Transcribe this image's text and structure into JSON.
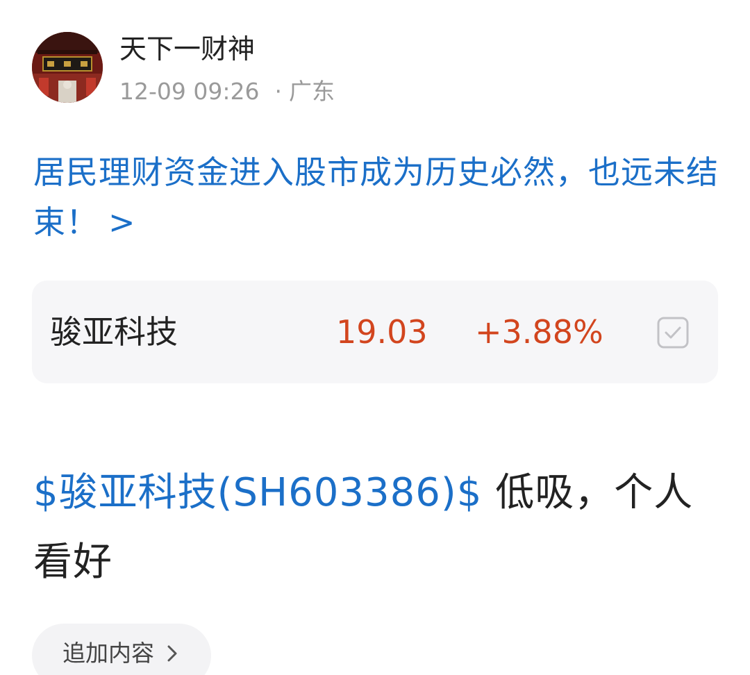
{
  "author": {
    "name": "天下一财神",
    "timestamp": "12-09 09:26",
    "separator": "·",
    "location": "广东"
  },
  "post": {
    "title": "居民理财资金进入股市成为历史必然，也远未结束！",
    "title_chevron": ">",
    "body_stock_tag": "$骏亚科技(SH603386)$",
    "body_text": " 低吸，个人看好"
  },
  "stock_card": {
    "name": "骏亚科技",
    "price": "19.03",
    "change": "+3.88%",
    "watch_icon": "checkbox-icon"
  },
  "actions": {
    "add_content_label": "追加内容",
    "add_content_icon": "chevron-right-icon"
  },
  "colors": {
    "link": "#1b6fc8",
    "price_up": "#d2451e",
    "text": "#222222",
    "muted": "#9a9a9a",
    "card_bg": "#f6f6f8"
  }
}
